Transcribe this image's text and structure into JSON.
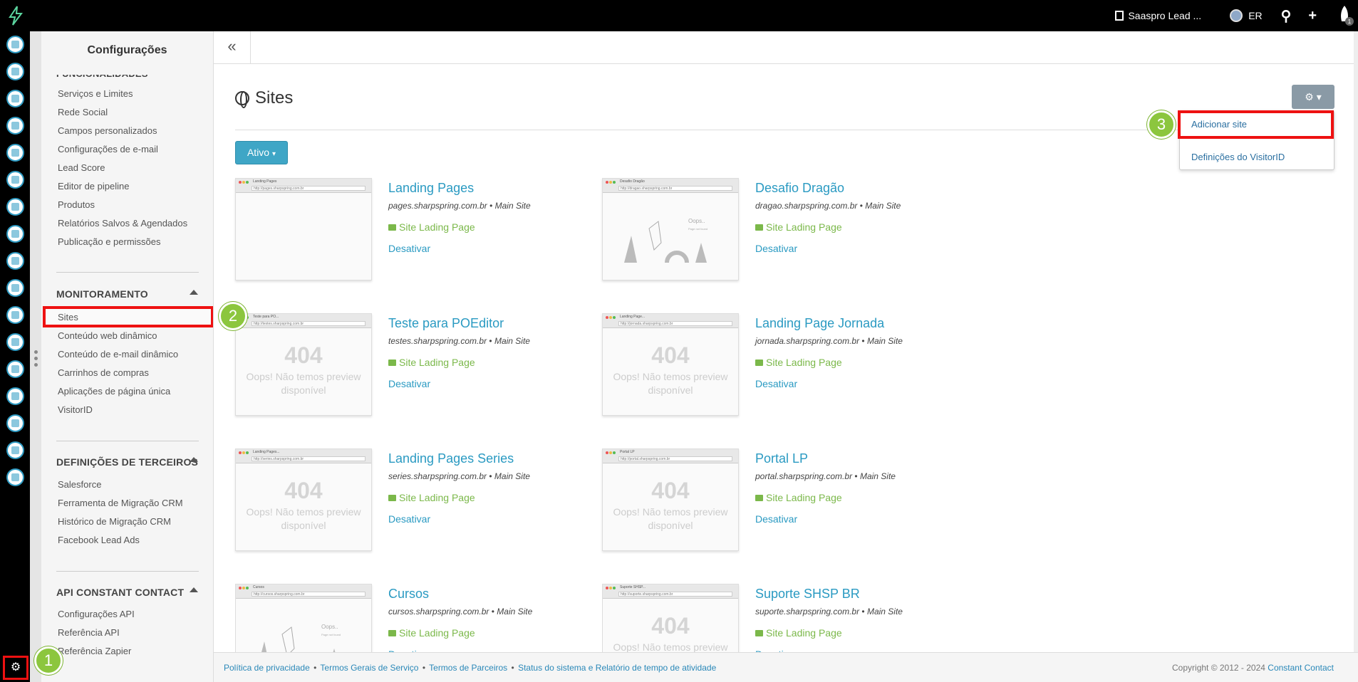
{
  "topbar": {
    "account_name": "Saaspro Lead ...",
    "user_initials": "ER",
    "notification_count": "1"
  },
  "rail": {
    "icons": [
      "contacts-icon",
      "email-icon",
      "clipboard-icon",
      "map-icon",
      "pipeline-icon",
      "list-icon",
      "megaphone-icon",
      "chat-icon",
      "thumbs-up-icon",
      "gallery-icon",
      "calendar-icon",
      "handshake-icon",
      "analytics-icon",
      "support-icon",
      "add-user-icon",
      "bar-chart-icon",
      "plug-icon"
    ],
    "settings_icon": "gear-icon"
  },
  "sidebar": {
    "title": "Configurações",
    "truncated_heading": "FUNCIONALIDADES",
    "features_items": [
      "Serviços e Limites",
      "Rede Social",
      "Campos personalizados",
      "Configurações de e-mail",
      "Lead Score",
      "Editor de pipeline",
      "Produtos",
      "Relatórios Salvos & Agendados",
      "Publicação e permissões"
    ],
    "monitoring_heading": "MONITORAMENTO",
    "monitoring_items": [
      "Sites",
      "Conteúdo web dinâmico",
      "Conteúdo de e-mail dinâmico",
      "Carrinhos de compras",
      "Aplicações de página única",
      "VisitorID"
    ],
    "third_party_heading": "DEFINIÇÕES DE TERCEIROS",
    "third_party_items": [
      "Salesforce",
      "Ferramenta de Migração CRM",
      "Histórico de Migração CRM",
      "Facebook Lead Ads"
    ],
    "api_heading": "API CONSTANT CONTACT",
    "api_items": [
      "Configurações API",
      "Referência API",
      "Referência Zapier"
    ]
  },
  "main": {
    "collapse_label": "«",
    "page_title": "Sites",
    "filter_label": "Ativo",
    "dropdown": {
      "items": [
        "Adicionar site",
        "Definições do VisitorID"
      ]
    }
  },
  "callouts": [
    "1",
    "2",
    "3"
  ],
  "sites": [
    {
      "name": "Landing Pages",
      "url": "pages.sharpspring.com.br",
      "scope": "Main Site",
      "type": "Site Lading Page",
      "action": "Desativar",
      "thumb": "blank",
      "tab": "Landing Pages",
      "thumb_url": "http://pages.sharpspring.com.br"
    },
    {
      "name": "Desafio Dragão",
      "url": "dragao.sharpspring.com.br",
      "scope": "Main Site",
      "type": "Site Lading Page",
      "action": "Desativar",
      "thumb": "oops",
      "tab": "Desafio Dragão",
      "thumb_url": "http://dragao.sharpspring.com.br"
    },
    {
      "name": "Teste para POEditor",
      "url": "testes.sharpspring.com.br",
      "scope": "Main Site",
      "type": "Site Lading Page",
      "action": "Desativar",
      "thumb": "404",
      "tab": "Teste para PO...",
      "thumb_url": "http://testes.sharpspring.com.br"
    },
    {
      "name": "Landing Page Jornada",
      "url": "jornada.sharpspring.com.br",
      "scope": "Main Site",
      "type": "Site Lading Page",
      "action": "Desativar",
      "thumb": "404",
      "tab": "Landing Page...",
      "thumb_url": "http://jornada.sharpspring.com.br"
    },
    {
      "name": "Landing Pages Series",
      "url": "series.sharpspring.com.br",
      "scope": "Main Site",
      "type": "Site Lading Page",
      "action": "Desativar",
      "thumb": "404",
      "tab": "Landing Pages...",
      "thumb_url": "http://series.sharpspring.com.br"
    },
    {
      "name": "Portal LP",
      "url": "portal.sharpspring.com.br",
      "scope": "Main Site",
      "type": "Site Lading Page",
      "action": "Desativar",
      "thumb": "404",
      "tab": "Portal LP",
      "thumb_url": "http://portal.sharpspring.com.br"
    },
    {
      "name": "Cursos",
      "url": "cursos.sharpspring.com.br",
      "scope": "Main Site",
      "type": "Site Lading Page",
      "action": "Desativar",
      "thumb": "oops",
      "tab": "Cursos",
      "thumb_url": "http://cursos.sharpspring.com.br"
    },
    {
      "name": "Suporte SHSP BR",
      "url": "suporte.sharpspring.com.br",
      "scope": "Main Site",
      "type": "Site Lading Page",
      "action": "Desativar",
      "thumb": "404",
      "tab": "Suporte SHSP...",
      "thumb_url": "http://suporte.sharpspring.com.br"
    }
  ],
  "thumb_text": {
    "code": "404",
    "message_line1": "Oops! Não temos preview",
    "message_line2": "disponível",
    "oops_heading": "Oops..",
    "oops_sub": "Page not found"
  },
  "footer": {
    "links": [
      "Política de privacidade",
      "Termos Gerais de Serviço",
      "Termos de Parceiros",
      "Status do sistema e Relatório de tempo de atividade"
    ],
    "bullet": "•",
    "copyright": "Copyright © 2012 - 2024",
    "brand": "Constant Contact"
  }
}
